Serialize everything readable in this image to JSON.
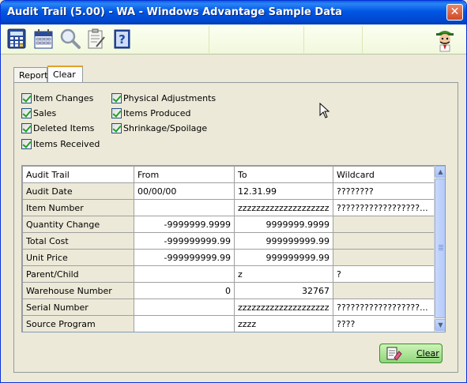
{
  "window": {
    "title": "Audit Trail (5.00) - WA - Windows Advantage Sample Data",
    "close_glyph": "✕"
  },
  "toolbar": {
    "buttons": [
      {
        "icon": "calculator-icon"
      },
      {
        "icon": "calendar-icon"
      },
      {
        "icon": "magnifier-icon"
      },
      {
        "icon": "clipboard-icon"
      },
      {
        "icon": "help-book-icon"
      }
    ],
    "mascot_icon": "mascot-icon"
  },
  "tabs": [
    {
      "label": "Report",
      "active": false
    },
    {
      "label": "Clear",
      "active": true
    }
  ],
  "checkboxes": [
    {
      "label": "Item Changes",
      "checked": true
    },
    {
      "label": "Sales",
      "checked": true
    },
    {
      "label": "Deleted Items",
      "checked": true
    },
    {
      "label": "Items Received",
      "checked": true
    },
    {
      "label": "Physical Adjustments",
      "checked": true
    },
    {
      "label": "Items Produced",
      "checked": true
    },
    {
      "label": "Shrinkage/Spoilage",
      "checked": true
    }
  ],
  "grid": {
    "columns": [
      "Audit Trail",
      "From",
      "To",
      "Wildcard"
    ],
    "rows": [
      {
        "field": "Audit Date",
        "from": "00/00/00",
        "to": "12.31.99",
        "wildcard": "????????"
      },
      {
        "field": "Item Number",
        "from": "",
        "to": "zzzzzzzzzzzzzzzzzzzz",
        "wildcard": "??????????????????..."
      },
      {
        "field": "Quantity Change",
        "from": "-9999999.9999",
        "to": "9999999.9999",
        "wildcard": ""
      },
      {
        "field": "Total Cost",
        "from": "-999999999.99",
        "to": "999999999.99",
        "wildcard": ""
      },
      {
        "field": "Unit Price",
        "from": "-999999999.99",
        "to": "999999999.99",
        "wildcard": ""
      },
      {
        "field": "Parent/Child",
        "from": "",
        "to": "z",
        "wildcard": "?"
      },
      {
        "field": "Warehouse Number",
        "from": "0",
        "to": "32767",
        "wildcard": ""
      },
      {
        "field": "Serial Number",
        "from": "",
        "to": "zzzzzzzzzzzzzzzzzzzz",
        "wildcard": "??????????????????..."
      },
      {
        "field": "Source Program",
        "from": "",
        "to": "zzzz",
        "wildcard": "????"
      }
    ]
  },
  "clear_button": {
    "label": "Clear",
    "icon": "eraser-icon"
  }
}
